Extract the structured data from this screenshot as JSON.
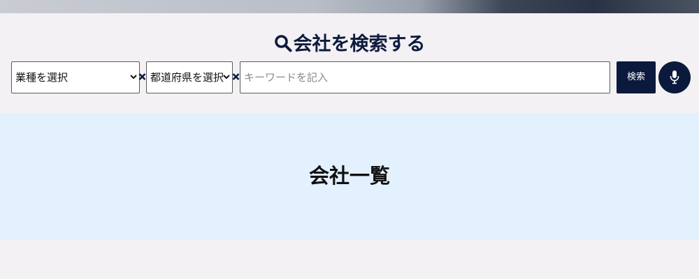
{
  "search": {
    "title": "会社を検索する",
    "industry_select": "業種を選択",
    "prefecture_select": "都道府県を選択",
    "keyword_placeholder": "キーワードを記入",
    "keyword_value": "",
    "search_button": "検索"
  },
  "list": {
    "title": "会社一覧"
  },
  "colors": {
    "navy": "#0b1a3c",
    "background": "#f3f1f4",
    "list_band": "#e3f0fe"
  },
  "icons": [
    "search-icon",
    "chevron-down-icon",
    "clear-icon",
    "microphone-icon"
  ]
}
